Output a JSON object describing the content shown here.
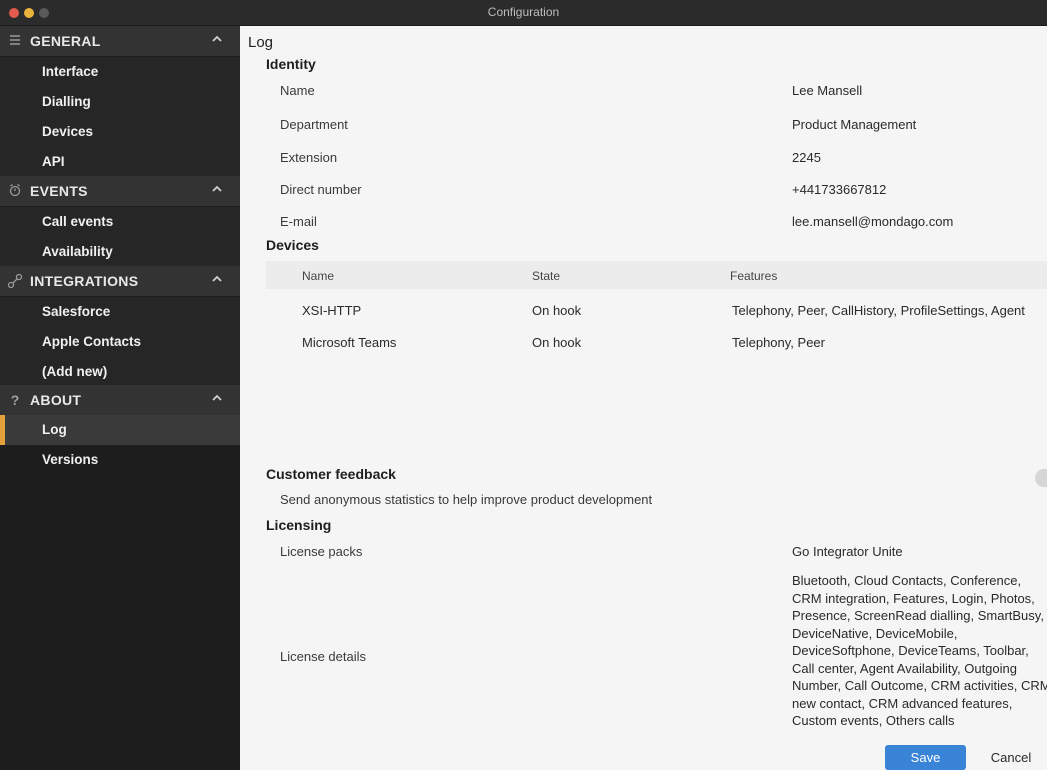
{
  "window": {
    "title": "Configuration"
  },
  "sidebar": {
    "sections": [
      {
        "label": "GENERAL",
        "icon": "hamburger-icon",
        "items": [
          "Interface",
          "Dialling",
          "Devices",
          "API"
        ]
      },
      {
        "label": "EVENTS",
        "icon": "events-icon",
        "items": [
          "Call events",
          "Availability"
        ]
      },
      {
        "label": "INTEGRATIONS",
        "icon": "integrations-icon",
        "items": [
          "Salesforce",
          "Apple Contacts",
          "(Add new)"
        ]
      },
      {
        "label": "ABOUT",
        "icon": "question-icon",
        "items": [
          "Log",
          "Versions"
        ]
      }
    ],
    "active_item": "Log",
    "accent_color": "#e3a13a"
  },
  "main": {
    "title": "Log",
    "identity": {
      "heading": "Identity",
      "rows": [
        {
          "label": "Name",
          "value": "Lee Mansell"
        },
        {
          "label": "Department",
          "value": "Product Management"
        },
        {
          "label": "Extension",
          "value": "2245"
        },
        {
          "label": "Direct number",
          "value": "+441733667812"
        },
        {
          "label": "E-mail",
          "value": "lee.mansell@mondago.com"
        }
      ]
    },
    "devices": {
      "heading": "Devices",
      "columns": [
        "Name",
        "State",
        "Features"
      ],
      "rows": [
        [
          "XSI-HTTP",
          "On hook",
          "Telephony, Peer, CallHistory, ProfileSettings, Agent"
        ],
        [
          "Microsoft Teams",
          "On hook",
          "Telephony, Peer"
        ]
      ]
    },
    "feedback": {
      "heading": "Customer feedback",
      "text": "Send anonymous statistics to help improve product development"
    },
    "licensing": {
      "heading": "Licensing",
      "packs_label": "License packs",
      "packs_value": "Go Integrator Unite",
      "details_label": "License details",
      "details_value": "Bluetooth, Cloud Contacts, Conference, CRM integration, Features, Login, Photos, Presence, ScreenRead dialling, SmartBusy, DeviceNative, DeviceMobile, DeviceSoftphone, DeviceTeams, Toolbar, Call center, Agent Availability, Outgoing Number, Call Outcome, CRM activities, CRM new contact, CRM advanced features, Custom events, Others calls"
    },
    "buttons": {
      "save": "Save",
      "cancel": "Cancel",
      "save_color": "#3a84d8"
    }
  }
}
